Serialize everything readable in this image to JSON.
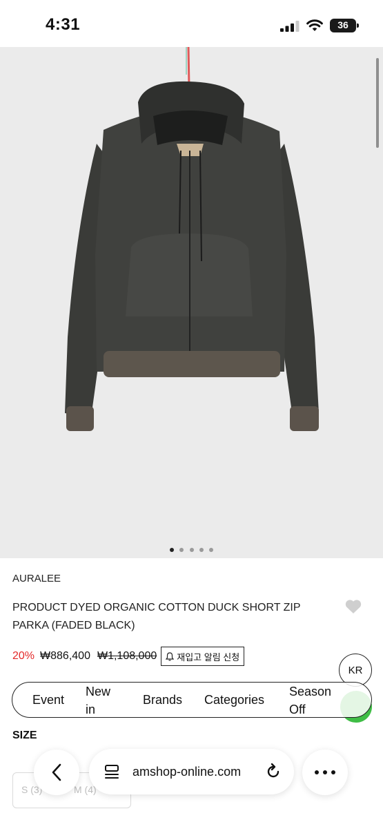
{
  "status_bar": {
    "time": "4:31",
    "battery": "36"
  },
  "product": {
    "brand": "AURALEE",
    "name": "PRODUCT DYED ORGANIC COTTON DUCK SHORT ZIP PARKA (FADED BLACK)",
    "discount": "20%",
    "price": "₩886,400",
    "original_price": "₩1,108,000",
    "restock_label": "재입고 알림 신청",
    "image_dots": 5,
    "active_dot": 0
  },
  "language_button": "KR",
  "category_nav": {
    "items": [
      "Event",
      "New in",
      "Brands",
      "Categories",
      "Season Off"
    ]
  },
  "size_section": {
    "label": "SIZE",
    "options": [
      "S (3)",
      "M (4)"
    ]
  },
  "browser": {
    "url": "amshop-online.com"
  },
  "colors": {
    "discount": "#e32a2a",
    "green_fab": "#3fbd45",
    "image_bg": "#ebebeb"
  },
  "icons": [
    "signal-icon",
    "wifi-icon",
    "battery-icon",
    "heart-icon",
    "bell-icon",
    "back-icon",
    "tabs-icon",
    "reload-icon",
    "more-icon"
  ]
}
